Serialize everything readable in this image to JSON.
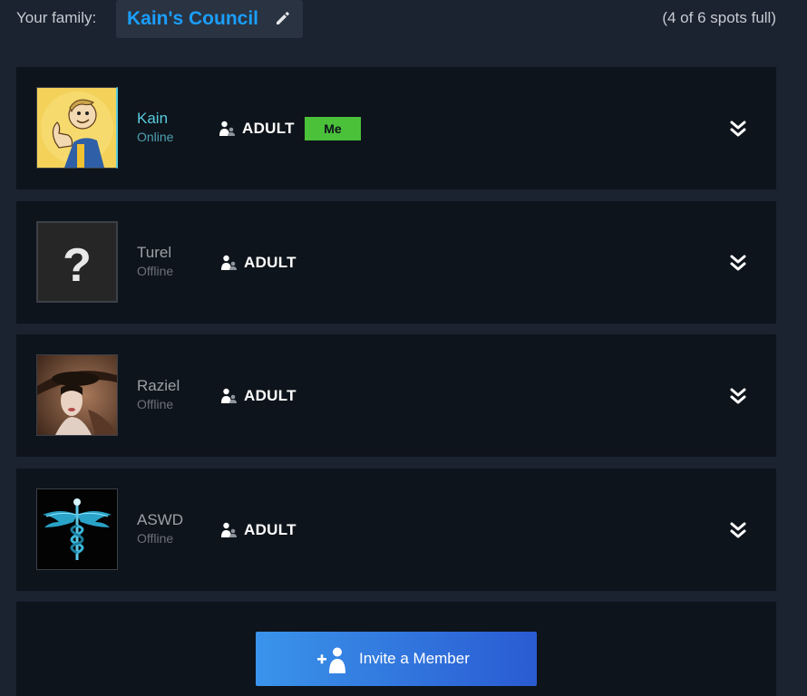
{
  "header": {
    "your_family_label": "Your family:",
    "family_name": "Kain's Council",
    "spots": "(4 of 6 spots full)"
  },
  "members": [
    {
      "name": "Kain",
      "status": "Online",
      "role": "ADULT",
      "badge": "Me",
      "avatar": "vault-boy-thumbs-up"
    },
    {
      "name": "Turel",
      "status": "Offline",
      "role": "ADULT",
      "avatar": "question-mark-placeholder"
    },
    {
      "name": "Raziel",
      "status": "Offline",
      "role": "ADULT",
      "avatar": "woman-in-wide-brim-hat"
    },
    {
      "name": "ASWD",
      "status": "Offline",
      "role": "ADULT",
      "avatar": "blue-caduceus"
    }
  ],
  "invite": {
    "label": "Invite a Member",
    "icon": "add-person-icon"
  },
  "colors": {
    "accent": "#1a9fff",
    "online": "#57cbde",
    "me_badge": "#4bc13a",
    "card_bg": "#0e141b",
    "page_bg": "#1b2230"
  }
}
